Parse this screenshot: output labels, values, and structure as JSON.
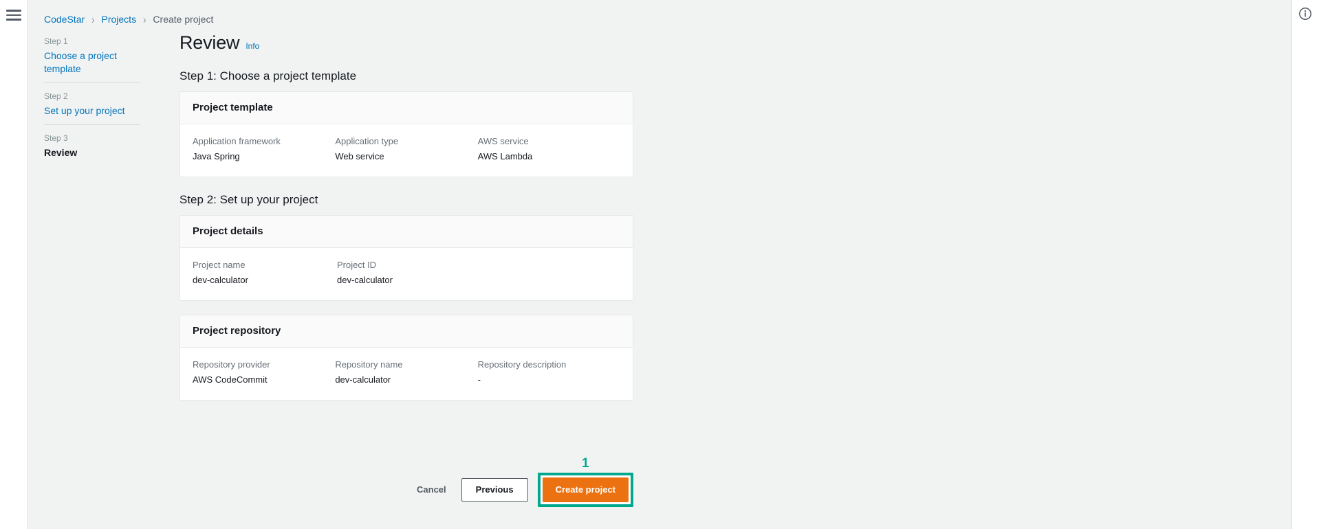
{
  "chrome": {
    "menu_icon": "hamburger-menu-icon",
    "info_icon": "info-circle-icon"
  },
  "breadcrumb": {
    "items": [
      {
        "label": "CodeStar",
        "current": false
      },
      {
        "label": "Projects",
        "current": false
      },
      {
        "label": "Create project",
        "current": true
      }
    ],
    "separator": "›"
  },
  "stepnav": {
    "steps": [
      {
        "number": "Step 1",
        "label": "Choose a project template",
        "active": false
      },
      {
        "number": "Step 2",
        "label": "Set up your project",
        "active": false
      },
      {
        "number": "Step 3",
        "label": "Review",
        "active": true
      }
    ]
  },
  "page": {
    "title": "Review",
    "info_label": "Info"
  },
  "sections": [
    {
      "heading": "Step 1: Choose a project template",
      "cards": [
        {
          "title": "Project template",
          "fields": [
            {
              "label": "Application framework",
              "value": "Java Spring"
            },
            {
              "label": "Application type",
              "value": "Web service"
            },
            {
              "label": "AWS service",
              "value": "AWS Lambda"
            }
          ]
        }
      ]
    },
    {
      "heading": "Step 2: Set up your project",
      "cards": [
        {
          "title": "Project details",
          "fields": [
            {
              "label": "Project name",
              "value": "dev-calculator"
            },
            {
              "label": "Project ID",
              "value": "dev-calculator"
            }
          ]
        },
        {
          "title": "Project repository",
          "fields": [
            {
              "label": "Repository provider",
              "value": "AWS CodeCommit"
            },
            {
              "label": "Repository name",
              "value": "dev-calculator"
            },
            {
              "label": "Repository description",
              "value": "-"
            }
          ]
        }
      ]
    }
  ],
  "actions": {
    "cancel_label": "Cancel",
    "previous_label": "Previous",
    "create_label": "Create project",
    "highlight_badge": "1"
  },
  "colors": {
    "primary_button": "#ec7211",
    "highlight": "#00a88e",
    "link": "#0073bb",
    "page_background": "#f1f3f3",
    "card_background": "#ffffff"
  }
}
